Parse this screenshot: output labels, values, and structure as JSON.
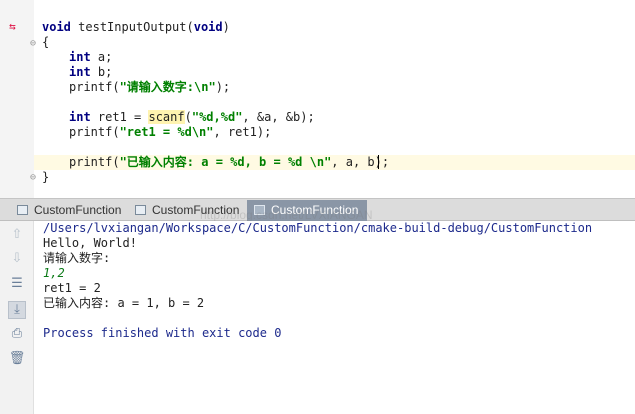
{
  "editor": {
    "lines": [
      {
        "text": "void testInputOutput(void)"
      },
      {
        "text": "{"
      },
      {
        "text": "int a;"
      },
      {
        "text": "int b;"
      },
      {
        "text": "printf(\"请输入数字:\\n\");"
      },
      {
        "text": ""
      },
      {
        "text": "int ret1 = scanf(\"%d,%d\", &a, &b);"
      },
      {
        "text": "printf(\"ret1 = %d\\n\", ret1);"
      },
      {
        "text": ""
      },
      {
        "text": "printf(\"已输入内容: a = %d, b = %d \\n\", a, b);"
      },
      {
        "text": "}"
      }
    ]
  },
  "tabs": [
    {
      "label": "CustomFunction",
      "active": false
    },
    {
      "label": "CustomFunction",
      "active": false
    },
    {
      "label": "CustomFunction",
      "active": true
    }
  ],
  "console": {
    "path": "/Users/lvxiangan/Workspace/C/CustomFunction/cmake-build-debug/CustomFunction",
    "hello": "Hello, World!",
    "prompt": "请输入数字:",
    "input": "1,2",
    "ret": "ret1 = 2",
    "result": "已输入内容: a = 1, b = 2",
    "exit": "Process finished with exit code 0"
  },
  "watermark": "http://blog.csdn.net/LVXIANGAN",
  "toolbar_icons": [
    "arrow-up-icon",
    "arrow-down-icon",
    "soft-wrap-icon",
    "scroll-to-end-icon",
    "print-icon",
    "trash-icon"
  ]
}
